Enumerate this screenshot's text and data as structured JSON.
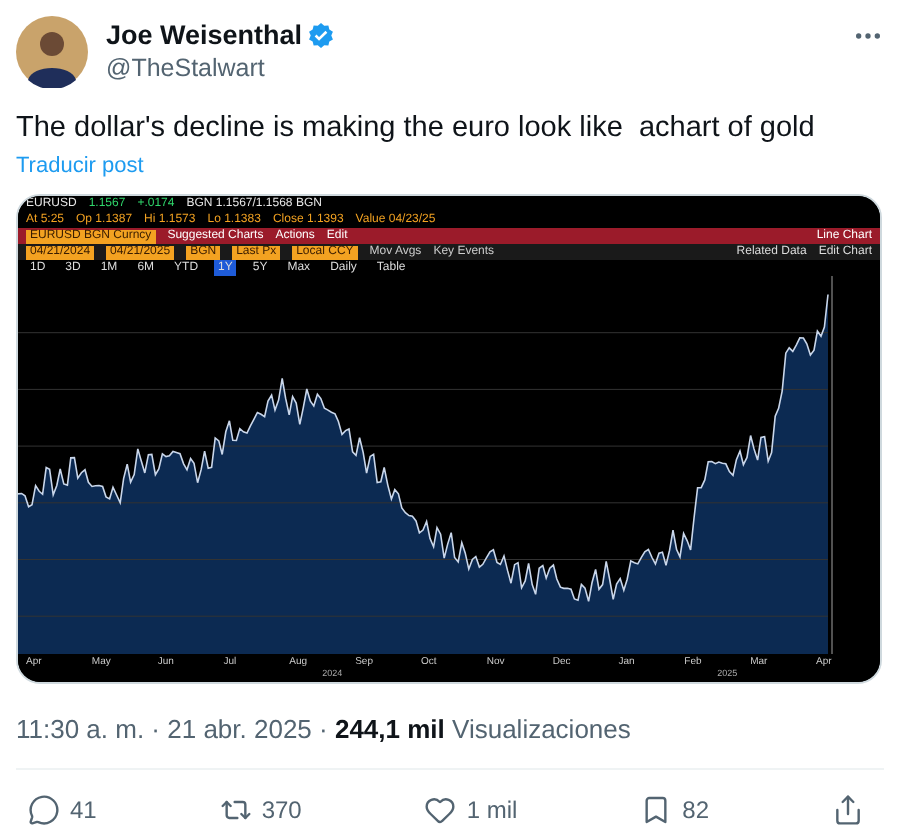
{
  "post": {
    "author": {
      "name": "Joe Weisenthal",
      "handle": "@TheStalwart",
      "verified": true
    },
    "text": "The dollar's decline is making the euro look like  achart of gold",
    "translate_link": "Traducir post"
  },
  "media": {
    "terminal": {
      "quote_row": [
        {
          "text": "EURUSD",
          "kind": "label"
        },
        {
          "text": "1.1567",
          "kind": "up"
        },
        {
          "text": "+.0174",
          "kind": "up"
        },
        {
          "text": "BGN 1.1567/1.1568 BGN",
          "kind": "label"
        }
      ],
      "stats_row": [
        {
          "text": "At 5:25",
          "kind": "label"
        },
        {
          "text": "Op 1.1387",
          "kind": "label"
        },
        {
          "text": "Hi 1.1573",
          "kind": "label"
        },
        {
          "text": "Lo 1.1383",
          "kind": "label"
        },
        {
          "text": "Close 1.1393",
          "kind": "label"
        },
        {
          "text": "Value 04/23/25",
          "kind": "label"
        }
      ],
      "menu_row": {
        "security": "EURUSD BGN Curncy",
        "menus": [
          "Suggested Charts",
          "Actions",
          "Edit"
        ],
        "chart_type": "Line Chart"
      },
      "fields_row": {
        "fields": [
          "04/21/2024",
          "04/21/2025",
          "BGN",
          "Last Px",
          "Local CCY"
        ],
        "options": [
          "Mov Avgs",
          "Key Events"
        ],
        "right": [
          "Related Data",
          "Edit Chart"
        ]
      },
      "periods": [
        {
          "label": "1D",
          "selected": false
        },
        {
          "label": "3D",
          "selected": false
        },
        {
          "label": "1M",
          "selected": false
        },
        {
          "label": "6M",
          "selected": false
        },
        {
          "label": "YTD",
          "selected": false
        },
        {
          "label": "1Y",
          "selected": true
        },
        {
          "label": "5Y",
          "selected": false
        },
        {
          "label": "Max",
          "selected": false
        },
        {
          "label": "Daily",
          "selected": false
        },
        {
          "label": "Table",
          "selected": false
        }
      ],
      "months": [
        "Apr",
        "May",
        "Jun",
        "Jul",
        "Aug",
        "Sep",
        "Oct",
        "Nov",
        "Dec",
        "Jan",
        "Feb",
        "Mar",
        "Apr"
      ],
      "years": [
        "2024",
        "2025"
      ]
    }
  },
  "meta": "11:30 a. m. · 21 abr. 2025 · **244,1 mil** Visualizaciones",
  "actions": [
    {
      "kind": "reply",
      "count": "41"
    },
    {
      "kind": "repost",
      "count": "370"
    },
    {
      "kind": "like",
      "count": "1 mil"
    },
    {
      "kind": "bookmark",
      "count": "82"
    },
    {
      "kind": "share"
    }
  ]
}
